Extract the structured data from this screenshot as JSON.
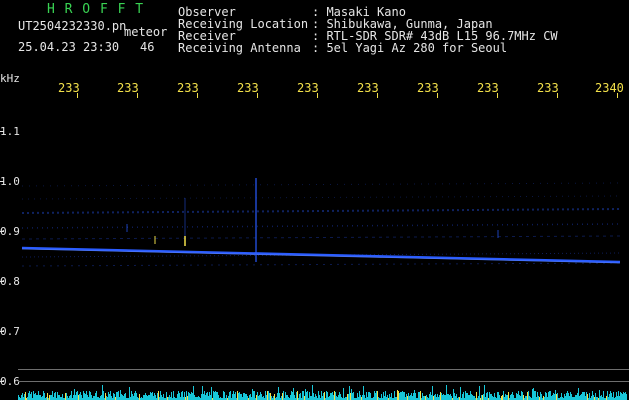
{
  "header": {
    "brand": "H R O F F T",
    "file_name": "UT2504232330.pn",
    "datetime": "25.04.23 23:30",
    "event_label": "meteor",
    "count": "46",
    "fields": [
      {
        "label": "Observer",
        "value": ": Masaki Kano"
      },
      {
        "label": "Receiving Location",
        "value": ": Shibukawa, Gunma, Japan"
      },
      {
        "label": "Receiver",
        "value": ": RTL-SDR SDR# 43dB L15 96.7MHz CW"
      },
      {
        "label": "Receiving Antenna",
        "value": ": 5el Yagi Az 280 for Seoul"
      }
    ]
  },
  "axis": {
    "unit": "kHz",
    "time_ticks": [
      "233",
      "233",
      "233",
      "233",
      "233",
      "233",
      "233",
      "233",
      "233",
      "2340"
    ],
    "freq_ticks": [
      "1.1",
      "1.0",
      "0.9",
      "0.8",
      "0.7",
      "0.6"
    ]
  },
  "colors": {
    "header_green": "#39d353",
    "axis_yellow": "#f2e04a",
    "signal_blue": "#2a5cff",
    "noise_cyan": "#18c6d8"
  }
}
